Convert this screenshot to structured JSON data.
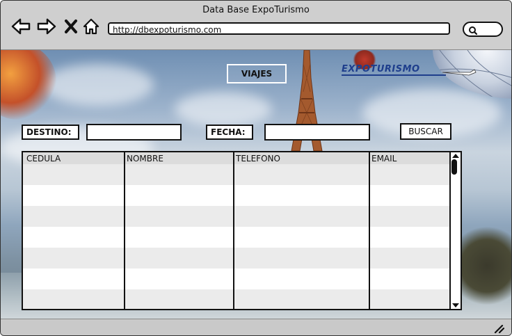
{
  "window": {
    "title": "Data Base ExpoTurismo"
  },
  "browser": {
    "url": "http://dbexpoturismo.com",
    "icons": [
      "back-arrow-icon",
      "forward-arrow-icon",
      "close-x-icon",
      "home-icon",
      "search-icon"
    ]
  },
  "page": {
    "viajes_label": "VIAJES",
    "logo_text": "EXPOTURISMO",
    "destino_label": "DESTINO:",
    "destino_value": "",
    "fecha_label": "FECHA:",
    "fecha_value": "",
    "buscar_label": "BUSCAR"
  },
  "table": {
    "columns": [
      "CEDULA",
      "NOMBRE",
      "TELEFONO",
      "EMAIL"
    ],
    "rows": [
      [
        "",
        "",
        "",
        ""
      ],
      [
        "",
        "",
        "",
        ""
      ],
      [
        "",
        "",
        "",
        ""
      ],
      [
        "",
        "",
        "",
        ""
      ],
      [
        "",
        "",
        "",
        ""
      ],
      [
        "",
        "",
        "",
        ""
      ],
      [
        "",
        "",
        "",
        ""
      ]
    ]
  },
  "colors": {
    "logo_blue": "#1e3e8c",
    "chrome_gray": "#c9c9c9"
  }
}
